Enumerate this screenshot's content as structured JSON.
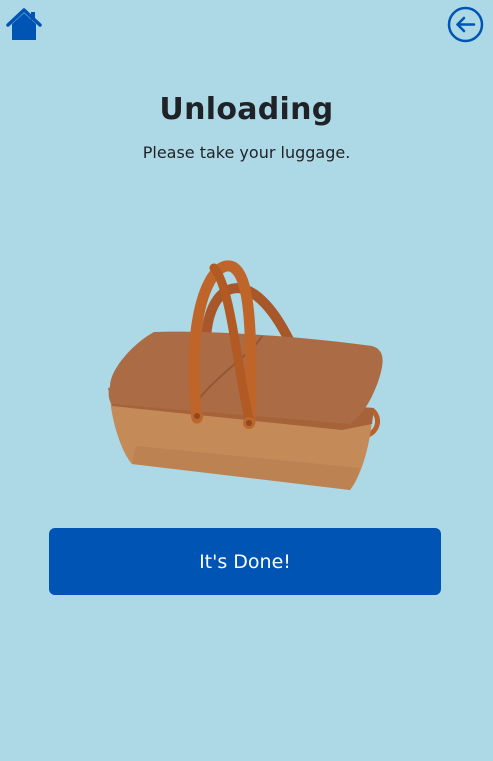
{
  "nav": {
    "home_icon": "home-icon",
    "back_icon": "arrow-left-circle-icon"
  },
  "header": {
    "title": "Unloading",
    "subtitle": "Please take your luggage."
  },
  "illustration": {
    "icon": "picnic-basket-icon"
  },
  "actions": {
    "done_label": "It's Done!"
  },
  "colors": {
    "background": "#add8e6",
    "accent": "#0054b4",
    "text": "#1f2328"
  }
}
